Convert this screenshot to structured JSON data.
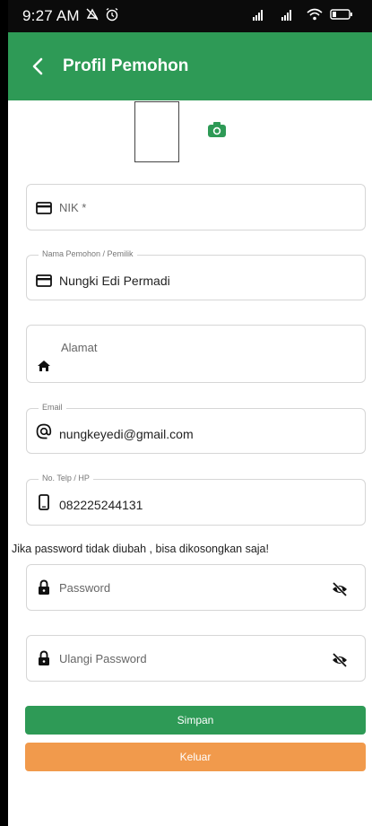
{
  "status_bar": {
    "time": "9:27 AM"
  },
  "header": {
    "title": "Profil Pemohon"
  },
  "form": {
    "nik": {
      "placeholder": "NIK *",
      "value": ""
    },
    "nama": {
      "label": "Nama Pemohon / Pemilik",
      "value": "Nungki Edi Permadi"
    },
    "alamat": {
      "placeholder": "Alamat",
      "value": ""
    },
    "email": {
      "label": "Email",
      "value": "nungkeyedi@gmail.com"
    },
    "telp": {
      "label": "No. Telp / HP",
      "value": "082225244131"
    },
    "hint": "Jika password tidak diubah , bisa dikosongkan saja!",
    "password": {
      "placeholder": "Password"
    },
    "ulangi_password": {
      "placeholder": "Ulangi Password"
    }
  },
  "buttons": {
    "save": "Simpan",
    "exit": "Keluar"
  },
  "colors": {
    "primary": "#2e9a56",
    "secondary": "#f19a4c",
    "status_bar": "#0b0b0b"
  },
  "icons": {
    "back": "chevron-left-icon",
    "camera": "camera-icon",
    "nik": "id-card-icon",
    "nama": "id-card-icon",
    "alamat": "home-icon",
    "email": "at-icon",
    "telp": "phone-icon",
    "password": "lock-icon",
    "visibility": "eye-off-icon"
  }
}
